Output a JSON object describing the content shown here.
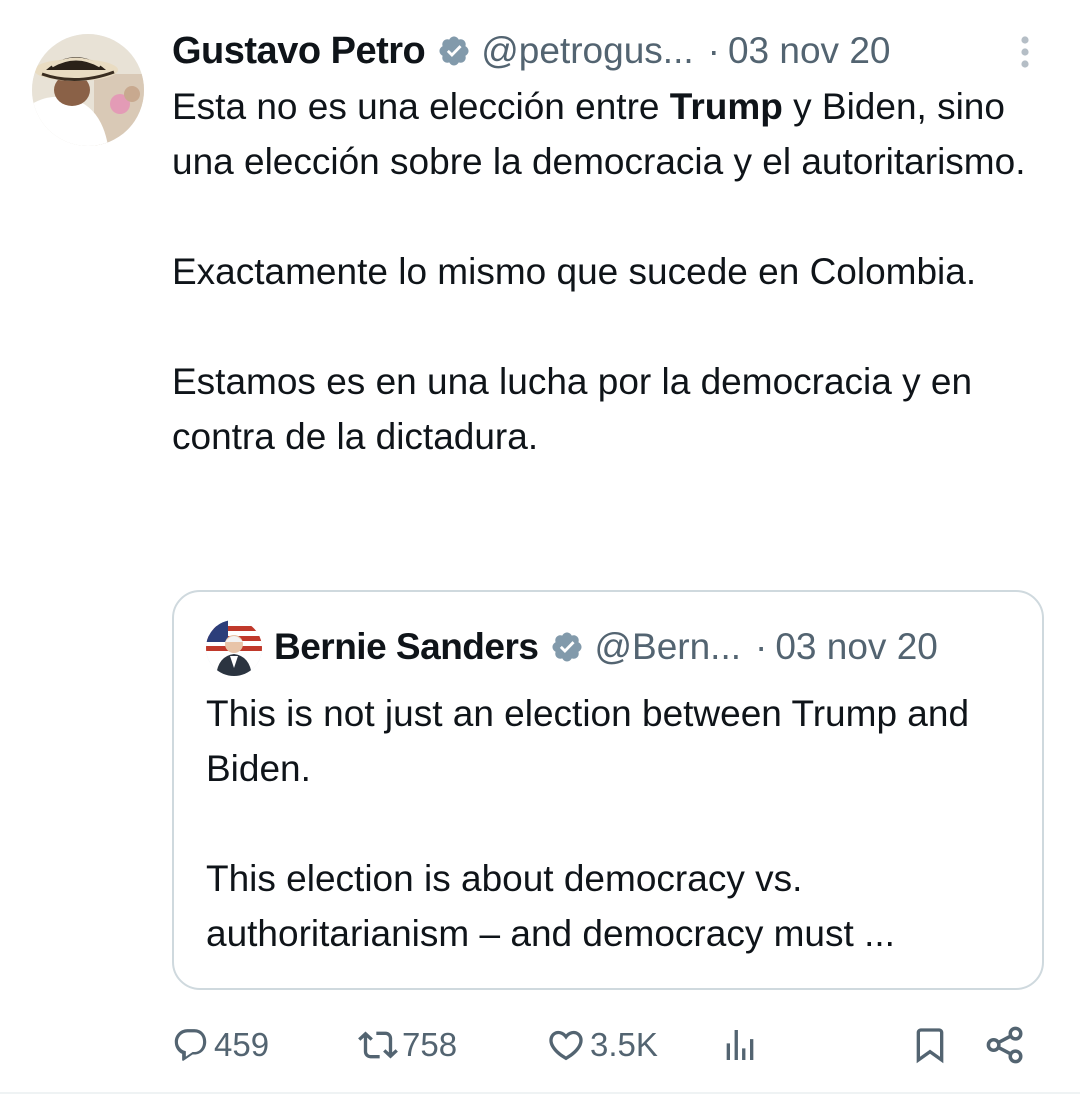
{
  "tweet": {
    "author": {
      "name": "Gustavo Petro",
      "handle": "@petrogus...",
      "time": "03 nov 20",
      "separator": "·"
    },
    "text": {
      "p1_before": "Esta no es una elección entre ",
      "p1_bold": "Trump",
      "p1_after": " y Biden, sino una elección sobre la democracia y el autoritarismo.",
      "p2": "Exactamente lo mismo que sucede en Colombia.",
      "p3": "Estamos es en una lucha por la democracia y en contra de la dictadura."
    },
    "quoted": {
      "name": "Bernie Sanders",
      "handle": "@Bern...",
      "time": "03 nov 20",
      "separator": "·",
      "p1": "This is not just an election between Trump and Biden.",
      "p2": "This election is about democracy vs. authoritarianism – and democracy must ..."
    },
    "actions": {
      "replies": "459",
      "retweets": "758",
      "likes": "3.5K"
    },
    "icons": {
      "verified": "verified-badge-icon",
      "more": "more-options-icon",
      "reply": "reply-icon",
      "retweet": "retweet-icon",
      "like": "heart-icon",
      "views": "views-icon",
      "bookmark": "bookmark-icon",
      "share": "share-icon"
    },
    "colors": {
      "text": "#0f1419",
      "secondary": "#536471",
      "verified": "#829aab",
      "border": "#cfd9de"
    }
  }
}
